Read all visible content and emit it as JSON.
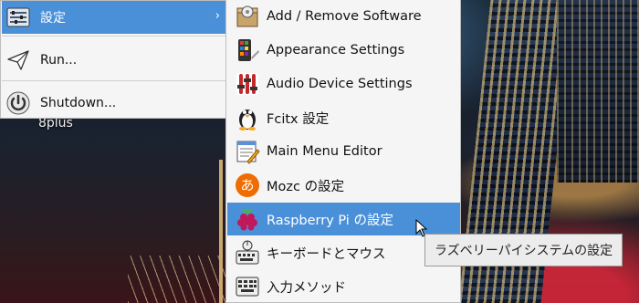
{
  "desktop": {
    "label": "8plus"
  },
  "main_menu": {
    "items": [
      {
        "label": "設定",
        "icon": "settings-panel-icon",
        "active": true,
        "has_submenu": true
      },
      {
        "label": "Run...",
        "icon": "paper-plane-icon"
      },
      {
        "label": "Shutdown...",
        "icon": "power-icon"
      }
    ]
  },
  "submenu": {
    "items": [
      {
        "label": "Add / Remove Software",
        "icon": "package-icon"
      },
      {
        "label": "Appearance Settings",
        "icon": "appearance-icon"
      },
      {
        "label": "Audio Device Settings",
        "icon": "audio-mixer-icon"
      },
      {
        "label": "Fcitx 設定",
        "icon": "penguin-icon"
      },
      {
        "label": "Main Menu Editor",
        "icon": "menu-editor-icon"
      },
      {
        "label": "Mozc の設定",
        "icon": "mozc-icon"
      },
      {
        "label": "Raspberry Pi の設定",
        "icon": "raspberry-icon",
        "active": true
      },
      {
        "label": "キーボードとマウス",
        "icon": "keyboard-mouse-icon"
      },
      {
        "label": "入力メソッド",
        "icon": "keyboard-icon"
      }
    ]
  },
  "tooltip": {
    "text": "ラズベリーパイシステムの設定"
  },
  "colors": {
    "highlight": "#4a90d9",
    "menu_bg": "#f5f5f5"
  }
}
